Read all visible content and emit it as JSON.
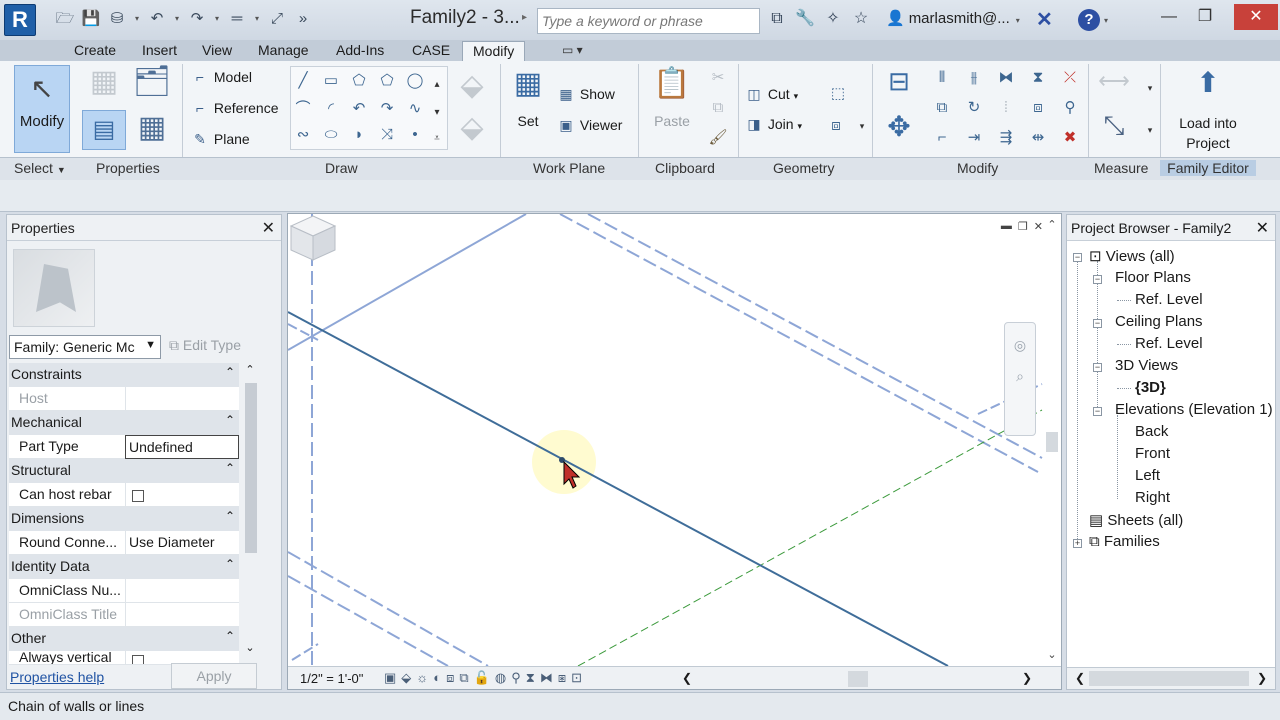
{
  "titlebar": {
    "app_letter": "R",
    "document_title": "Family2 - 3...",
    "search_placeholder": "Type a keyword or phrase",
    "user_name": "marlasmith@...",
    "help_label": "?"
  },
  "tabs": [
    "Create",
    "Insert",
    "View",
    "Manage",
    "Add-Ins",
    "CASE",
    "Modify"
  ],
  "active_tab": "Modify",
  "ribbon": {
    "select_modify_label": "Modify",
    "draw_items": {
      "model": "Model",
      "reference": "Reference",
      "plane": "Plane"
    },
    "workplane": {
      "set": "Set",
      "show": "Show",
      "viewer": "Viewer"
    },
    "clipboard": {
      "paste": "Paste"
    },
    "geometry": {
      "cut": "Cut",
      "join": "Join"
    },
    "family_editor": {
      "load_line1": "Load into",
      "load_line2": "Project"
    },
    "panels": {
      "select": "Select",
      "properties": "Properties",
      "draw": "Draw",
      "work_plane": "Work Plane",
      "clipboard": "Clipboard",
      "geometry": "Geometry",
      "modify": "Modify",
      "measure": "Measure",
      "family_editor": "Family Editor"
    }
  },
  "properties": {
    "title": "Properties",
    "family_type": "Family: Generic Mc",
    "edit_type": "Edit Type",
    "groups": {
      "constraints": "Constraints",
      "mechanical": "Mechanical",
      "structural": "Structural",
      "dimensions": "Dimensions",
      "identity": "Identity Data",
      "other": "Other"
    },
    "rows": {
      "host": {
        "name": "Host",
        "value": ""
      },
      "part_type": {
        "name": "Part Type",
        "value": "Undefined"
      },
      "can_host_rebar": {
        "name": "Can host rebar"
      },
      "round_connector": {
        "name": "Round Conne...",
        "value": "Use Diameter"
      },
      "omniclass_number": {
        "name": "OmniClass Nu...",
        "value": ""
      },
      "omniclass_title": {
        "name": "OmniClass Title",
        "value": ""
      },
      "always_vertical": {
        "name": "Always vertical"
      }
    },
    "help_link": "Properties help",
    "apply": "Apply"
  },
  "view": {
    "scale": "1/2\" = 1'-0\""
  },
  "browser": {
    "title": "Project Browser - Family2",
    "views_all": "Views (all)",
    "floor_plans": "Floor Plans",
    "floor_ref_level": "Ref. Level",
    "ceiling_plans": "Ceiling Plans",
    "ceiling_ref_level": "Ref. Level",
    "views_3d": "3D Views",
    "view_3d": "{3D}",
    "elevations": "Elevations (Elevation 1)",
    "back": "Back",
    "front": "Front",
    "left": "Left",
    "right": "Right",
    "sheets": "Sheets (all)",
    "families": "Families"
  },
  "status": {
    "text": "Chain of walls or lines"
  },
  "colors": {
    "accent": "#1f5fa8",
    "ref_plane": "#8ea6d6",
    "model_line": "#3f6d99",
    "highlight": "#fffbd0"
  }
}
